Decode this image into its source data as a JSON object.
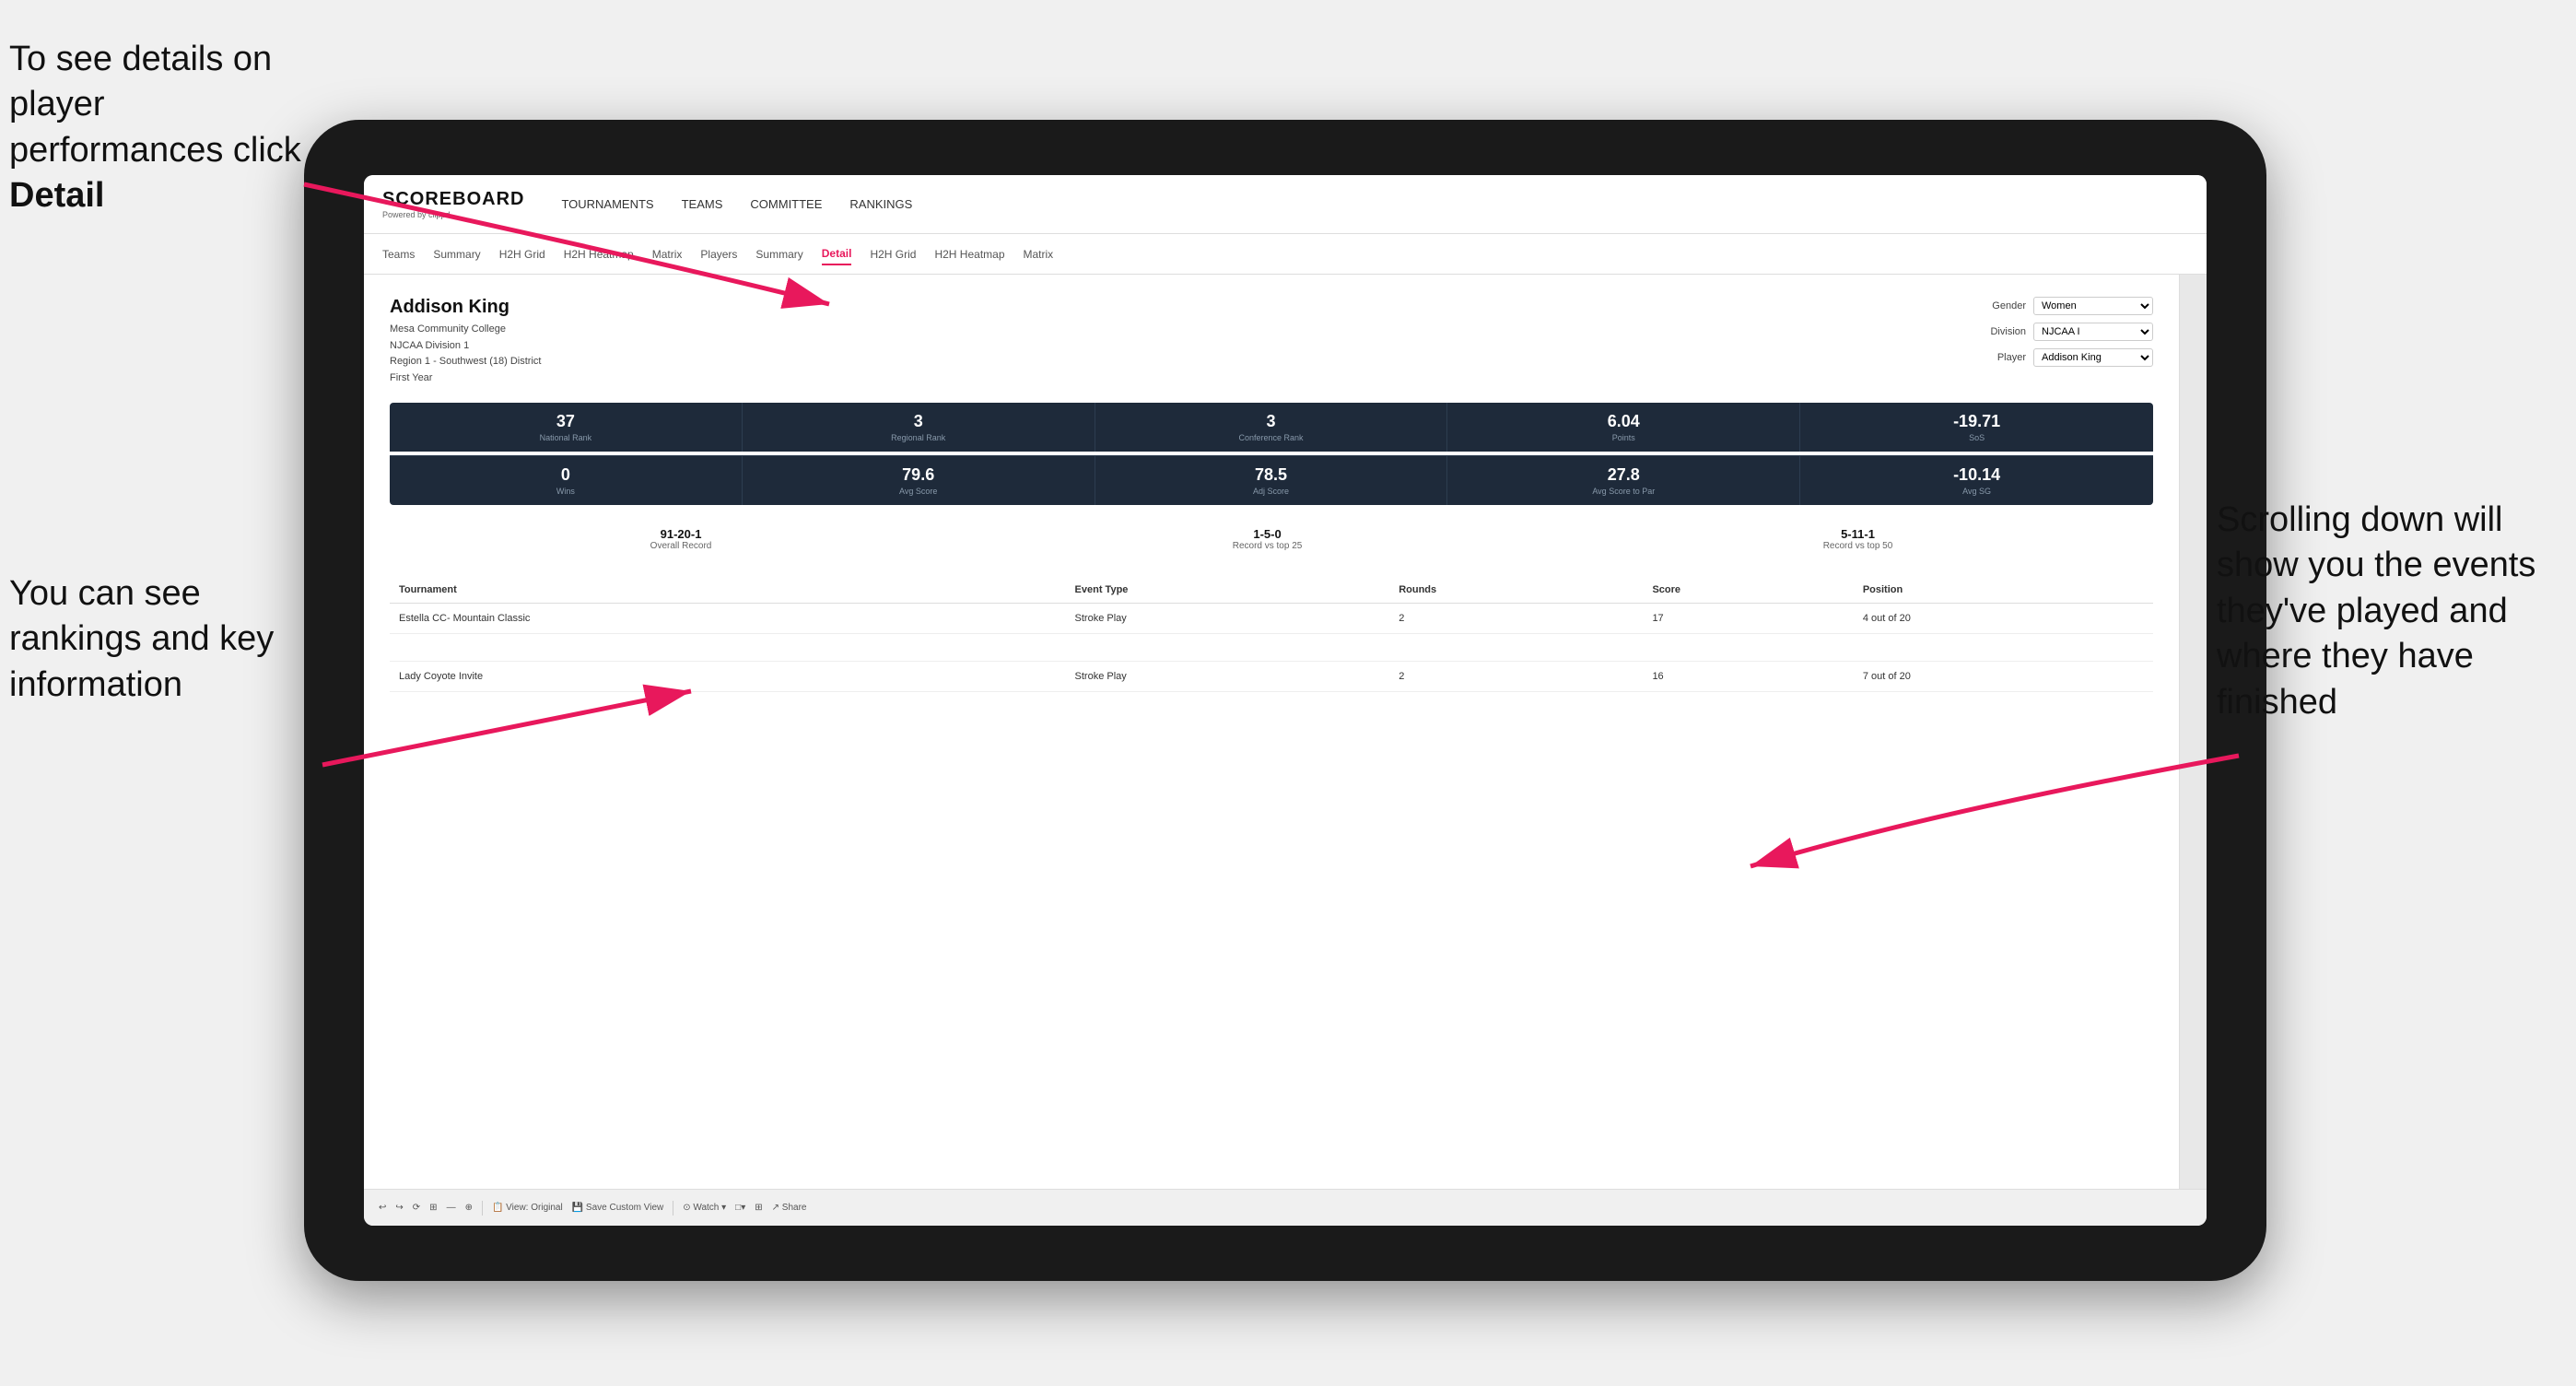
{
  "annotations": {
    "topleft": {
      "line1": "To see details on",
      "line2": "player performances",
      "line3_prefix": "click ",
      "line3_bold": "Detail"
    },
    "bottomleft": {
      "line1": "You can see",
      "line2": "rankings and",
      "line3": "key information"
    },
    "bottomright": {
      "line1": "Scrolling down",
      "line2": "will show you",
      "line3": "the events",
      "line4": "they've played",
      "line5": "and where they",
      "line6": "have finished"
    }
  },
  "nav": {
    "logo": "SCOREBOARD",
    "logo_sub": "Powered by clippd",
    "items": [
      "TOURNAMENTS",
      "TEAMS",
      "COMMITTEE",
      "RANKINGS"
    ]
  },
  "subnav": {
    "items": [
      "Teams",
      "Summary",
      "H2H Grid",
      "H2H Heatmap",
      "Matrix",
      "Players",
      "Summary",
      "Detail",
      "H2H Grid",
      "H2H Heatmap",
      "Matrix"
    ],
    "active": "Detail"
  },
  "player": {
    "name": "Addison King",
    "school": "Mesa Community College",
    "division": "NJCAA Division 1",
    "region": "Region 1 - Southwest (18) District",
    "year": "First Year"
  },
  "controls": {
    "gender_label": "Gender",
    "gender_value": "Women",
    "division_label": "Division",
    "division_value": "NJCAA I",
    "player_label": "Player",
    "player_value": "Addison King"
  },
  "stats_row1": [
    {
      "value": "37",
      "label": "National Rank"
    },
    {
      "value": "3",
      "label": "Regional Rank"
    },
    {
      "value": "3",
      "label": "Conference Rank"
    },
    {
      "value": "6.04",
      "label": "Points"
    },
    {
      "value": "-19.71",
      "label": "SoS"
    }
  ],
  "stats_row2": [
    {
      "value": "0",
      "label": "Wins"
    },
    {
      "value": "79.6",
      "label": "Avg Score"
    },
    {
      "value": "78.5",
      "label": "Adj Score"
    },
    {
      "value": "27.8",
      "label": "Avg Score to Par"
    },
    {
      "value": "-10.14",
      "label": "Avg SG"
    }
  ],
  "records": [
    {
      "value": "91-20-1",
      "label": "Overall Record"
    },
    {
      "value": "1-5-0",
      "label": "Record vs top 25"
    },
    {
      "value": "5-11-1",
      "label": "Record vs top 50"
    }
  ],
  "table": {
    "headers": [
      "Tournament",
      "Event Type",
      "Rounds",
      "Score",
      "Position"
    ],
    "rows": [
      {
        "tournament": "Estella CC- Mountain Classic",
        "event_type": "Stroke Play",
        "rounds": "2",
        "score": "17",
        "position": "4 out of 20"
      },
      {
        "tournament": "",
        "event_type": "",
        "rounds": "",
        "score": "",
        "position": ""
      },
      {
        "tournament": "Lady Coyote Invite",
        "event_type": "Stroke Play",
        "rounds": "2",
        "score": "16",
        "position": "7 out of 20"
      }
    ]
  },
  "toolbar": {
    "buttons": [
      "↩",
      "↪",
      "⟳",
      "⊞",
      "—",
      "⊕",
      "View: Original",
      "Save Custom View",
      "⊙ Watch ▾",
      "□▾",
      "⊞",
      "Share"
    ]
  }
}
